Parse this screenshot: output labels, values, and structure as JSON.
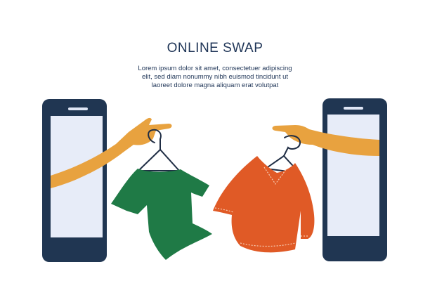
{
  "header": {
    "title": "ONLINE SWAP",
    "body": "Lorem ipsum dolor sit amet, consectetuer adipiscing elit, sed diam nonummy nibh euismod tincidunt ut laoreet dolore magna aliquam erat volutpat"
  },
  "colors": {
    "phone_frame": "#203652",
    "phone_screen": "#e7ecf8",
    "phone_notch": "#dfe6f5",
    "skin": "#e8a23f",
    "green_shirt": "#1f7a46",
    "orange_shirt": "#e05a26",
    "hanger": "#1f2d44",
    "text": "#1f3557"
  },
  "icons": [
    "left-phone-icon",
    "right-phone-icon",
    "left-hand-icon",
    "right-hand-icon",
    "green-shirt-icon",
    "orange-shirt-icon",
    "hanger-icon"
  ]
}
